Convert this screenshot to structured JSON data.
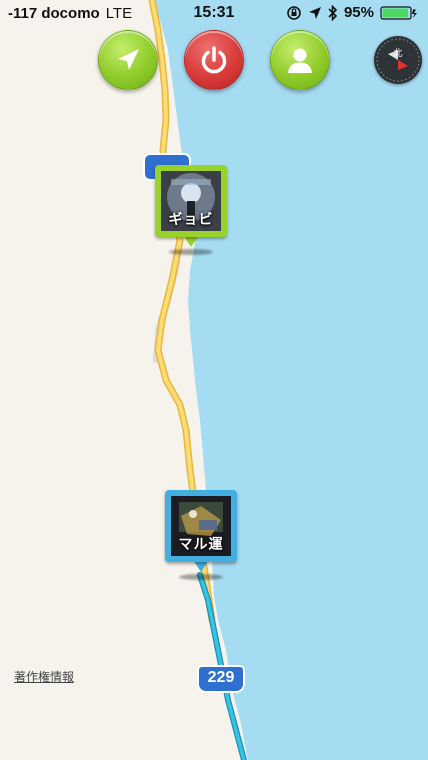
{
  "status_bar": {
    "carrier": "-117 docomo",
    "network": "LTE",
    "time": "15:31",
    "battery": "95%",
    "battery_level": 0.95
  },
  "controls": {
    "locate_icon": "navigation-arrow-icon",
    "power_icon": "power-icon",
    "user_icon": "person-icon",
    "compass_icon": "compass-icon"
  },
  "pins": [
    {
      "label": "ギョビ",
      "color": "#9ad22c"
    },
    {
      "label": "マル運",
      "color": "#43aee0"
    }
  ],
  "map": {
    "route_shield": "229",
    "copyright": "著作権情報",
    "colors": {
      "land": "#f6f3ec",
      "sea": "#a6dcf2",
      "road": "#f5c84a",
      "track": "#2bb3d8"
    }
  }
}
